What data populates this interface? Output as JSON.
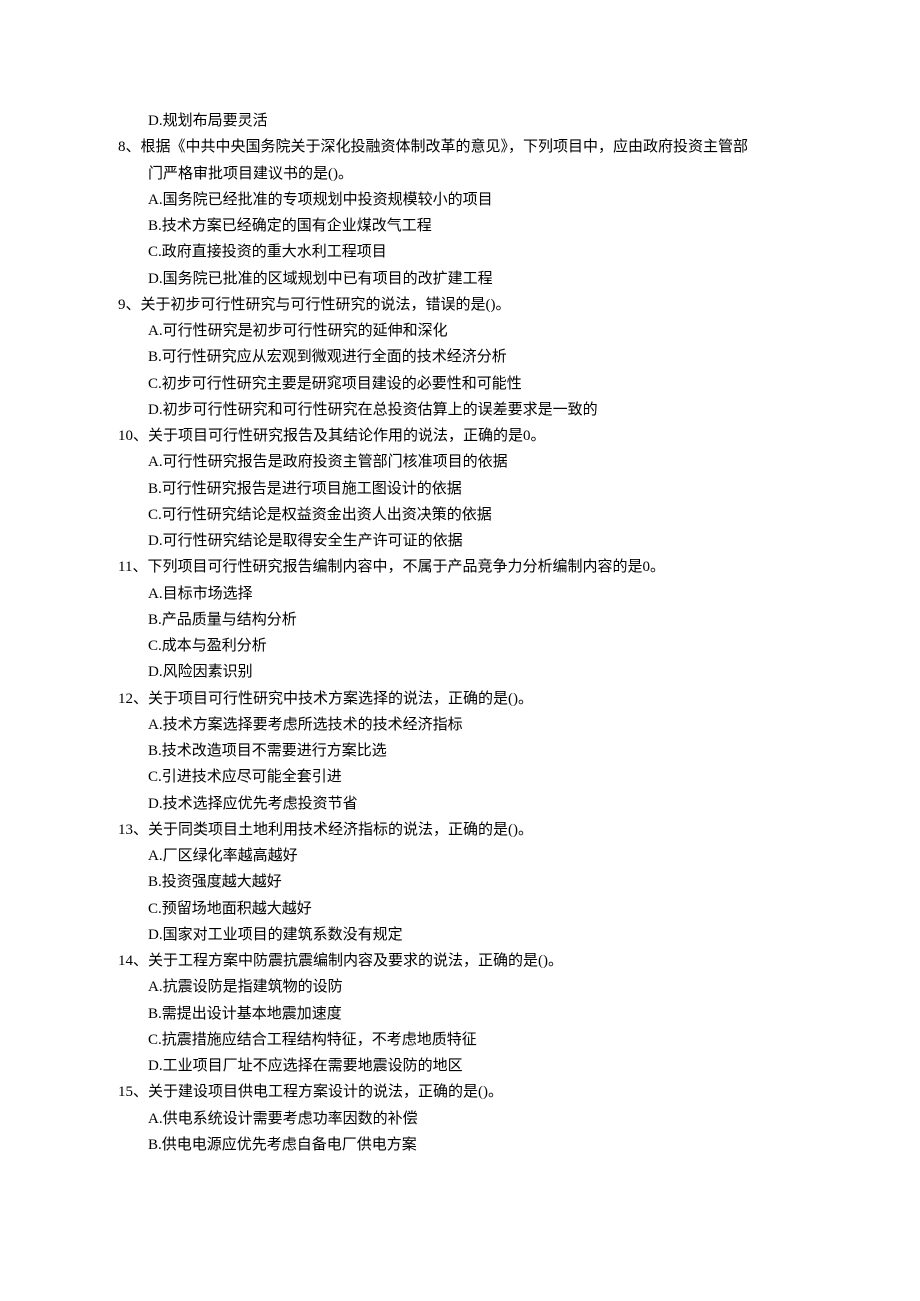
{
  "orphan_option": "D.规划布局要灵活",
  "questions": [
    {
      "number": "8、",
      "stem": "根据《中共中央国务院关于深化投融资体制改革的意见》，下列项目中，应由政府投资主管部门严格审批项目建议书的是()。",
      "options": [
        "A.国务院已经批准的专项规划中投资规模较小的项目",
        "B.技术方案已经确定的国有企业煤改气工程",
        "C.政府直接投资的重大水利工程项目",
        "D.国务院已批准的区域规划中已有项目的改扩建工程"
      ]
    },
    {
      "number": "9、",
      "stem": "关于初步可行性研究与可行性研究的说法，错误的是()。",
      "options": [
        "A.可行性研究是初步可行性研究的延伸和深化",
        "B.可行性研究应从宏观到微观进行全面的技术经济分析",
        "C.初步可行性研究主要是研窕项目建设的必要性和可能性",
        "D.初步可行性研究和可行性研究在总投资估算上的误差要求是一致的"
      ]
    },
    {
      "number": "10、",
      "stem": "关于项目可行性研究报告及其结论作用的说法，正确的是0。",
      "options": [
        "A.可行性研究报告是政府投资主管部门核准项目的依据",
        "B.可行性研究报告是进行项目施工图设计的依据",
        "C.可行性研究结论是权益资金出资人出资决策的依据",
        "D.可行性研究结论是取得安全生产许可证的依据"
      ]
    },
    {
      "number": "11、",
      "stem": "下列项目可行性研究报告编制内容中，不属于产品竞争力分析编制内容的是0。",
      "options": [
        "A.目标市场选择",
        "B.产品质量与结构分析",
        "C.成本与盈利分析",
        "D.风险因素识别"
      ]
    },
    {
      "number": "12、",
      "stem": "关于项目可行性研究中技术方案选择的说法，正确的是()。",
      "options": [
        "A.技术方案选择要考虑所选技术的技术经济指标",
        "B.技术改造项目不需要进行方案比选",
        "C.引进技术应尽可能全套引进",
        "D.技术选择应优先考虑投资节省"
      ]
    },
    {
      "number": "13、",
      "stem": "关于同类项目土地利用技术经济指标的说法，正确的是()。",
      "options": [
        "A.厂区绿化率越高越好",
        "B.投资强度越大越好",
        "C.预留场地面积越大越好",
        "D.国家对工业项目的建筑系数没有规定"
      ]
    },
    {
      "number": "14、",
      "stem": "关于工程方案中防震抗震编制内容及要求的说法，正确的是()。",
      "options": [
        "A.抗震设防是指建筑物的设防",
        "B.需提出设计基本地震加速度",
        "C.抗震措施应结合工程结构特征，不考虑地质特征",
        "D.工业项目厂址不应选择在需要地震设防的地区"
      ]
    },
    {
      "number": "15、",
      "stem": "关于建设项目供电工程方案设计的说法，正确的是()。",
      "options": [
        "A.供电系统设计需要考虑功率因数的补偿",
        "B.供电电源应优先考虑自备电厂供电方案"
      ]
    }
  ]
}
